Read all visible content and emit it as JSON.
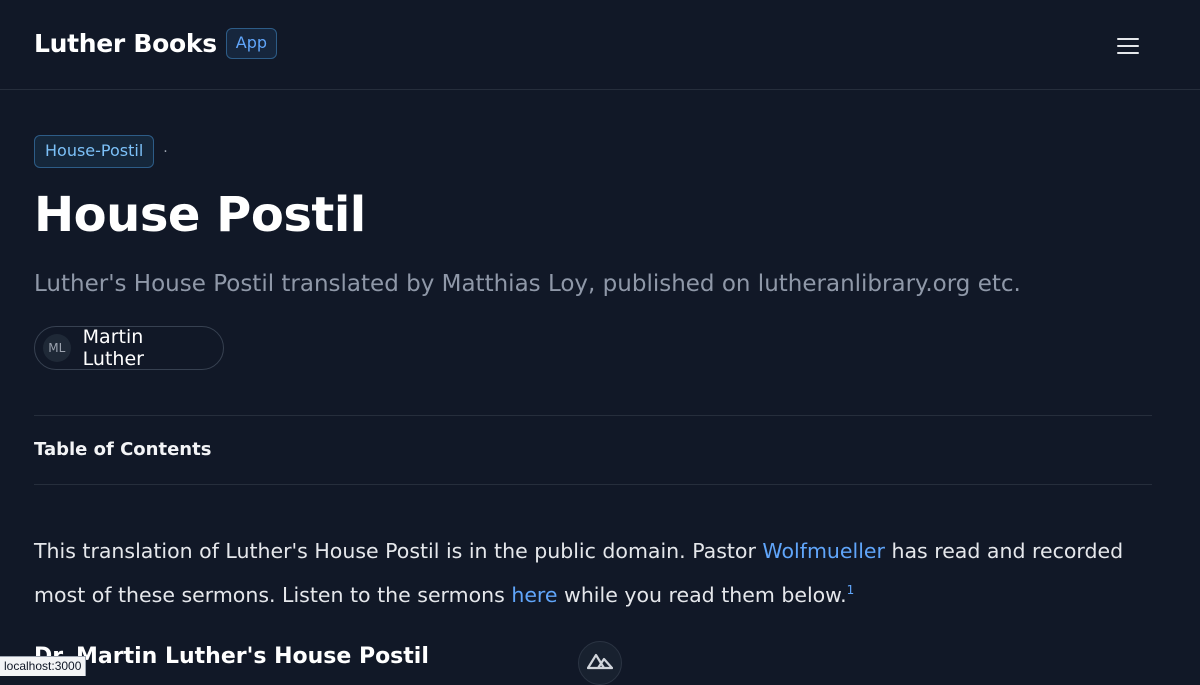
{
  "header": {
    "title": "Luther Books",
    "badge": "App",
    "menu_icon": "hamburger-menu-icon"
  },
  "book": {
    "tag": "House-Postil",
    "separator": "·",
    "title": "House Postil",
    "subtitle": "Luther's House Postil translated by Matthias Loy, published on lutheranlibrary.org etc.",
    "author": {
      "initials": "ML",
      "name": "Martin Luther"
    }
  },
  "toc": {
    "title": "Table of Contents"
  },
  "intro": {
    "text_before_link1": "This translation of Luther's House Postil is in the public domain. Pastor ",
    "link1": "Wolfmueller",
    "text_between": " has read and recorded most of these sermons. Listen to the sermons ",
    "link2": "here",
    "text_after": " while you read them below.",
    "footnote": "1"
  },
  "section": {
    "heading": "Dr. Martin Luther's House Postil"
  },
  "status_bar": {
    "url": "localhost:3000"
  },
  "devtools": {
    "icon": "nuxt-logo-icon"
  },
  "colors": {
    "background": "#111827",
    "accent": "#60a5fa",
    "muted": "#8f98a8"
  }
}
